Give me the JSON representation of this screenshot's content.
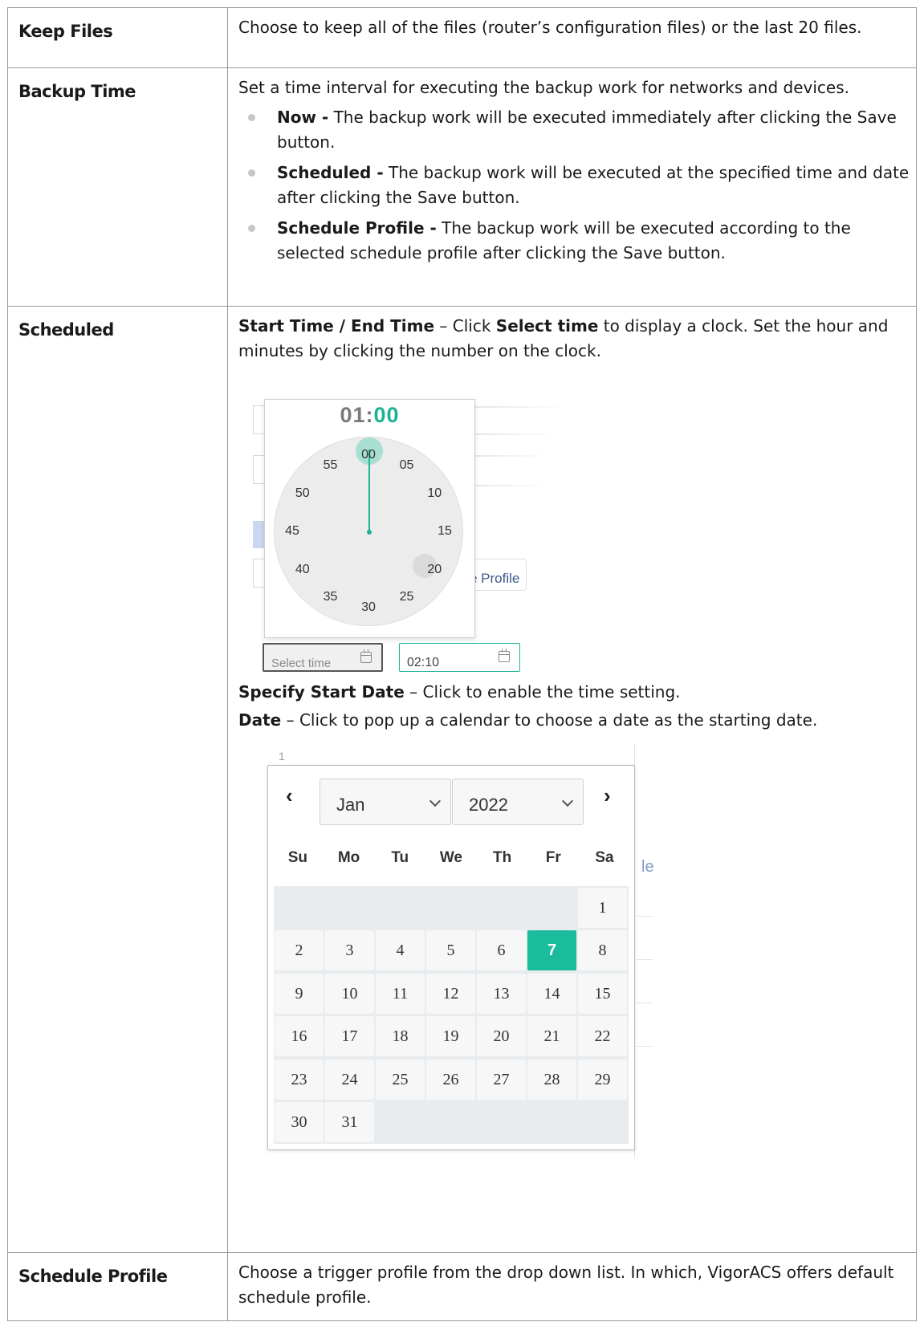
{
  "rows": [
    {
      "param": "Keep Files",
      "desc": "Choose to keep all of the files (router’s configuration files) or the last 20 files."
    },
    {
      "param": "Backup Time",
      "desc": "Set a time interval for executing the backup work for networks and devices.",
      "options": [
        {
          "term": "Now -",
          "text": " The backup work will be executed immediately after clicking the Save button."
        },
        {
          "term": "Scheduled -",
          "text": " The backup work will be executed at the specified time and date after clicking the Save button."
        },
        {
          "term": "Schedule Profile -",
          "text": " The backup work will be executed according to the selected schedule profile after clicking the Save button."
        }
      ]
    },
    {
      "param": "Scheduled",
      "line1_term1": "Start Time / End Time",
      "line1_mid": " – Click ",
      "line1_term2": "Select time",
      "line1_rest": " to display a clock. Set the hour and minutes by clicking the number on the clock.",
      "clock": {
        "hour": "01",
        "sep": ":",
        "minute": "00",
        "ticks": [
          "00",
          "05",
          "10",
          "15",
          "20",
          "25",
          "30",
          "35",
          "40",
          "45",
          "50",
          "55"
        ],
        "bg_profile_text": "e Profile"
      },
      "time_inputs": [
        {
          "placeholder": "Select time"
        },
        {
          "value": "02:10"
        }
      ],
      "start_date_term": "Specify Start Date",
      "start_date_text": " – Click to enable the time setting.",
      "date_term": "Date",
      "date_text": " – Click to pop up a calendar to choose a date as the starting date.",
      "calendar": {
        "prev": "‹",
        "next": "›",
        "month": "Jan",
        "year": "2022",
        "weekdays": [
          "Su",
          "Mo",
          "Tu",
          "We",
          "Th",
          "Fr",
          "Sa"
        ],
        "weeks": [
          [
            "",
            "",
            "",
            "",
            "",
            "",
            "1"
          ],
          [
            "2",
            "3",
            "4",
            "5",
            "6",
            "7",
            "8"
          ],
          [
            "9",
            "10",
            "11",
            "12",
            "13",
            "14",
            "15"
          ],
          [
            "16",
            "17",
            "18",
            "19",
            "20",
            "21",
            "22"
          ],
          [
            "23",
            "24",
            "25",
            "26",
            "27",
            "28",
            "29"
          ],
          [
            "30",
            "31",
            "",
            "",
            "",
            "",
            ""
          ]
        ],
        "selected_day": "7",
        "bg_top_text": "1",
        "bg_le_text": "le"
      }
    },
    {
      "param": "Schedule Profile",
      "desc": "Choose a trigger profile from the drop down list. In which, VigorACS offers default schedule profile."
    }
  ],
  "colors": {
    "accent": "#1bb394",
    "selected_day": "#1abc9c",
    "border": "#9a9a9a"
  }
}
